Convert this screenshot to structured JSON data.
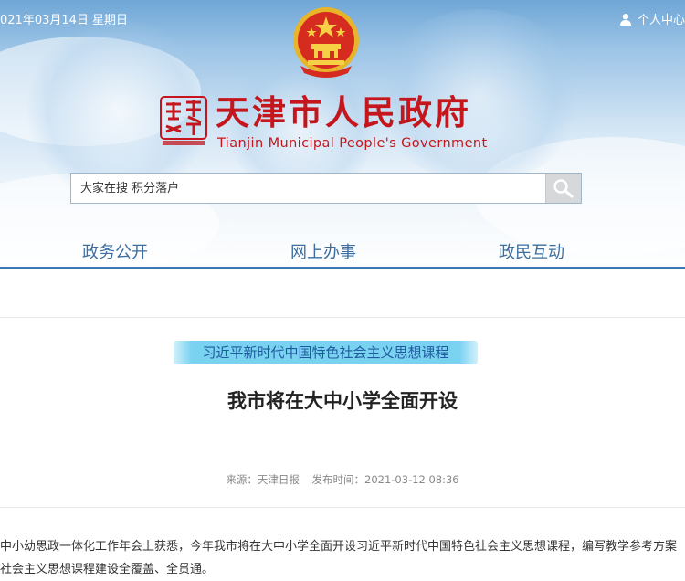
{
  "topbar": {
    "date": "021年03月14日 星期日",
    "personal_center": "个人中心"
  },
  "site": {
    "logo_text": "天津",
    "title": "天津市人民政府",
    "subtitle": "Tianjin Municipal People's Government"
  },
  "search": {
    "placeholder": "大家在搜 积分落户",
    "button_icon": "search-icon"
  },
  "nav": {
    "items": [
      {
        "label": "政务公开"
      },
      {
        "label": "网上办事"
      },
      {
        "label": "政民互动"
      }
    ]
  },
  "article": {
    "kicker": "习近平新时代中国特色社会主义思想课程",
    "headline": "我市将在大中小学全面开设",
    "source": "来源：天津日报",
    "published": "发布时间：2021-03-12 08:36",
    "paragraph_lines": [
      "中小幼思政一体化工作年会上获悉，今年我市将在大中小学全面开设习近平新时代中国特色社会主义思想课程，编写教学参考方案",
      "社会主义思想课程建设全覆盖、全贯通。"
    ]
  },
  "colors": {
    "title_red": "#c4161c",
    "nav_blue": "#3d6e9f",
    "nav_line": "#3b78ba",
    "kicker_highlight": "#7ad2f1"
  }
}
